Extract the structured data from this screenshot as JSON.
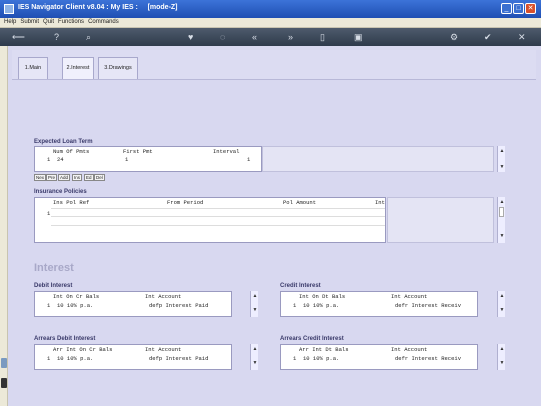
{
  "window": {
    "title": "IES Navigator Client v8.04 : My IES :",
    "mode": "[mode-Z]",
    "controls": [
      "_",
      "□",
      "✕"
    ]
  },
  "menu": [
    "Help",
    "Submit",
    "Quit",
    "Functions",
    "Commands"
  ],
  "toolbar": {
    "icons": [
      "back-arrow-icon",
      "help-icon",
      "search-icon",
      "heart-icon",
      "refresh-icon",
      "rewind-icon",
      "forward-icon",
      "document-icon",
      "save-icon",
      "settings-icon",
      "check-icon",
      "close-icon"
    ],
    "glyphs": [
      "⟵",
      "?",
      "⌕",
      "♥",
      "◌",
      "«",
      "»",
      "▯",
      "▣",
      "⚙",
      "✔",
      "✕"
    ]
  },
  "tabs": [
    {
      "label": "1.Main"
    },
    {
      "label": "2.Interest"
    },
    {
      "label": "3.Drawings"
    }
  ],
  "loan_term": {
    "title": "Expected Loan Term",
    "headers": [
      "Num Of Pmts",
      "First Pmt",
      "Interval"
    ],
    "rows": [
      {
        "n": "1",
        "c0": "24",
        "c1": "1",
        "c2": "1"
      }
    ]
  },
  "loan_buttons": [
    "Nex",
    "Pre",
    "Add",
    "Ins",
    "Ed",
    "Del"
  ],
  "insurance": {
    "title": "Insurance Policies",
    "headers": [
      "Ins Pol Ref",
      "From Period",
      "Pol Amount",
      "Int"
    ],
    "rows": [
      {
        "n": "1"
      }
    ]
  },
  "interest_title": "Interest",
  "debit": {
    "title": "Debit Interest",
    "headers": [
      "Int On Cr Bals",
      "Int Account"
    ],
    "row": {
      "n": "1",
      "c0": "10 10% p.a.",
      "c1": "defp Interest Paid"
    }
  },
  "credit": {
    "title": "Credit Interest",
    "headers": [
      "Int On Dt Bals",
      "Int Account"
    ],
    "row": {
      "n": "1",
      "c0": "10 10% p.a.",
      "c1": "defr Interest Receiv"
    }
  },
  "arrears_debit": {
    "title": "Arrears Debit Interest",
    "headers": [
      "Arr Int On Cr Bals",
      "Int Account"
    ],
    "row": {
      "n": "1",
      "c0": "10 10% p.a.",
      "c1": "defp Interest Paid"
    }
  },
  "arrears_credit": {
    "title": "Arrears Credit Interest",
    "headers": [
      "Arr Int Dt Bals",
      "Int Account"
    ],
    "row": {
      "n": "1",
      "c0": "10 10% p.a.",
      "c1": "defr Interest Receiv"
    }
  }
}
